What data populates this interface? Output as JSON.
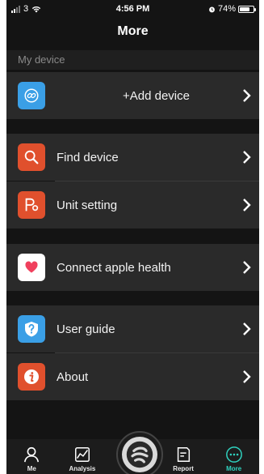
{
  "status_bar": {
    "carrier": "3",
    "time": "4:56 PM",
    "battery": "74%"
  },
  "header": {
    "title": "More"
  },
  "sections": {
    "my_device": {
      "header": "My device"
    }
  },
  "items": {
    "add_device": {
      "label": "+Add device",
      "icon": "link-icon",
      "color": "#3a9fe6"
    },
    "find_device": {
      "label": "Find device",
      "icon": "magnifier-icon",
      "color": "#e0502d"
    },
    "unit_setting": {
      "label": "Unit setting",
      "icon": "unit-icon",
      "color": "#e0502d"
    },
    "apple_health": {
      "label": "Connect apple health",
      "icon": "heart-icon",
      "color": "#ffffff"
    },
    "user_guide": {
      "label": "User guide",
      "icon": "question-icon",
      "color": "#3a9fe6"
    },
    "about": {
      "label": "About",
      "icon": "info-icon",
      "color": "#e0502d"
    }
  },
  "tab_bar": {
    "me": "Me",
    "analysis": "Analysis",
    "report": "Report",
    "more": "More",
    "active_color": "#2fd3c0"
  }
}
